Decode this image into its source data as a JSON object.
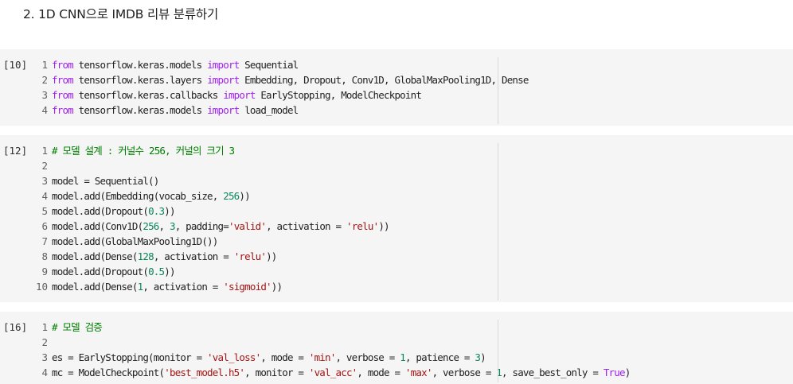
{
  "section": {
    "title": "2. 1D CNN으로 IMDB 리뷰 분류하기"
  },
  "cells": [
    {
      "exec_count": "[10]",
      "lines": [
        [
          [
            "kw",
            "from"
          ],
          [
            "t",
            " tensorflow.keras.models "
          ],
          [
            "kw",
            "import"
          ],
          [
            "t",
            " Sequential"
          ]
        ],
        [
          [
            "kw",
            "from"
          ],
          [
            "t",
            " tensorflow.keras.layers "
          ],
          [
            "kw",
            "import"
          ],
          [
            "t",
            " Embedding, Dropout, Conv1D, GlobalMaxPooling1D, Dense"
          ]
        ],
        [
          [
            "kw",
            "from"
          ],
          [
            "t",
            " tensorflow.keras.callbacks "
          ],
          [
            "kw",
            "import"
          ],
          [
            "t",
            " EarlyStopping, ModelCheckpoint"
          ]
        ],
        [
          [
            "kw",
            "from"
          ],
          [
            "t",
            " tensorflow.keras.models "
          ],
          [
            "kw",
            "import"
          ],
          [
            "t",
            " load_model"
          ]
        ]
      ]
    },
    {
      "exec_count": "[12]",
      "lines": [
        [
          [
            "cm",
            "# 모델 설계 : 커널수 256, 커널의 크기 3"
          ]
        ],
        [],
        [
          [
            "t",
            "model = Sequential()"
          ]
        ],
        [
          [
            "t",
            "model.add(Embedding(vocab_size, "
          ],
          [
            "num",
            "256"
          ],
          [
            "t",
            "))"
          ]
        ],
        [
          [
            "t",
            "model.add(Dropout("
          ],
          [
            "num",
            "0.3"
          ],
          [
            "t",
            "))"
          ]
        ],
        [
          [
            "t",
            "model.add(Conv1D("
          ],
          [
            "num",
            "256"
          ],
          [
            "t",
            ", "
          ],
          [
            "num",
            "3"
          ],
          [
            "t",
            ", padding="
          ],
          [
            "str",
            "'valid'"
          ],
          [
            "t",
            ", activation = "
          ],
          [
            "str",
            "'relu'"
          ],
          [
            "t",
            "))"
          ]
        ],
        [
          [
            "t",
            "model.add(GlobalMaxPooling1D())"
          ]
        ],
        [
          [
            "t",
            "model.add(Dense("
          ],
          [
            "num",
            "128"
          ],
          [
            "t",
            ", activation = "
          ],
          [
            "str",
            "'relu'"
          ],
          [
            "t",
            "))"
          ]
        ],
        [
          [
            "t",
            "model.add(Dropout("
          ],
          [
            "num",
            "0.5"
          ],
          [
            "t",
            "))"
          ]
        ],
        [
          [
            "t",
            "model.add(Dense("
          ],
          [
            "num",
            "1"
          ],
          [
            "t",
            ", activation = "
          ],
          [
            "str",
            "'sigmoid'"
          ],
          [
            "t",
            "))"
          ]
        ]
      ]
    },
    {
      "exec_count": "[16]",
      "lines": [
        [
          [
            "cm",
            "# 모델 검증"
          ]
        ],
        [],
        [
          [
            "t",
            "es = EarlyStopping(monitor = "
          ],
          [
            "str",
            "'val_loss'"
          ],
          [
            "t",
            ", mode = "
          ],
          [
            "str",
            "'min'"
          ],
          [
            "t",
            ", verbose = "
          ],
          [
            "num",
            "1"
          ],
          [
            "t",
            ", patience = "
          ],
          [
            "num",
            "3"
          ],
          [
            "t",
            ")"
          ]
        ],
        [
          [
            "t",
            "mc = ModelCheckpoint("
          ],
          [
            "str",
            "'best_model.h5'"
          ],
          [
            "t",
            ", monitor = "
          ],
          [
            "str",
            "'val_acc'"
          ],
          [
            "t",
            ", mode = "
          ],
          [
            "str",
            "'max'"
          ],
          [
            "t",
            ", verbose = "
          ],
          [
            "num",
            "1"
          ],
          [
            "t",
            ", save_best_only = "
          ],
          [
            "kw",
            "True"
          ],
          [
            "t",
            ")"
          ]
        ]
      ]
    }
  ]
}
